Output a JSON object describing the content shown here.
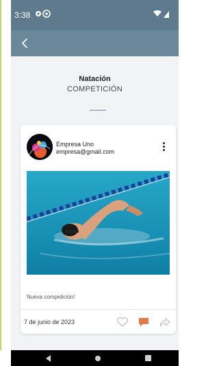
{
  "status": {
    "time": "3:38"
  },
  "header": {
    "title": "Natación",
    "subtitle": "COMPETICIÓN"
  },
  "post": {
    "author_name": "Empresa Uno",
    "author_email": "empresa@gmail.com",
    "text": "Nueva competición!",
    "date": "7 de junio de 2023"
  },
  "colors": {
    "statusbar": "#5f7a8d",
    "appbar": "#6b879a",
    "accent": "#e07a4b",
    "frame_edge": "#b7d96a"
  },
  "icons": {
    "back": "arrow-left-icon",
    "menu": "more-vertical-icon",
    "like": "heart-icon",
    "comment": "comment-icon",
    "share": "share-icon"
  }
}
